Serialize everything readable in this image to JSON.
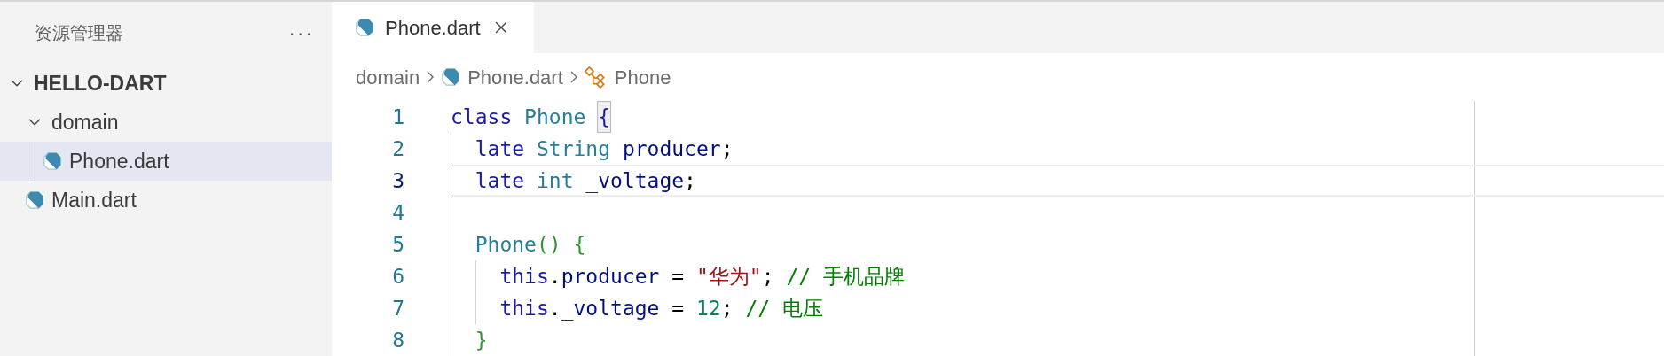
{
  "sidebar": {
    "title": "资源管理器",
    "more": "···",
    "tree": [
      {
        "kind": "folder",
        "label": "HELLO-DART",
        "bold": true,
        "expanded": true,
        "children": [
          {
            "kind": "folder",
            "label": "domain",
            "expanded": true,
            "children": [
              {
                "kind": "file",
                "label": "Phone.dart",
                "selected": true
              }
            ]
          },
          {
            "kind": "file",
            "label": "Main.dart",
            "selected": false
          }
        ]
      }
    ]
  },
  "tabs": [
    {
      "label": "Phone.dart",
      "selected": true
    }
  ],
  "breadcrumb": [
    {
      "kind": "folder",
      "label": "domain"
    },
    {
      "kind": "file",
      "label": "Phone.dart"
    },
    {
      "kind": "class",
      "label": "Phone"
    }
  ],
  "editor": {
    "lines": [
      {
        "number": "1",
        "current": false,
        "tokens": [
          {
            "kind": "keyword",
            "text": "class "
          },
          {
            "kind": "type",
            "text": "Phone "
          },
          {
            "kind": "bracket_match",
            "text": "{"
          }
        ]
      },
      {
        "number": "2",
        "current": false,
        "tokens": [
          {
            "kind": "keyword",
            "text": "  late "
          },
          {
            "kind": "type",
            "text": "String "
          },
          {
            "kind": "variable",
            "text": "producer"
          },
          {
            "kind": "plain",
            "text": ";"
          }
        ]
      },
      {
        "number": "3",
        "current": true,
        "tokens": [
          {
            "kind": "keyword",
            "text": "  late "
          },
          {
            "kind": "type",
            "text": "int "
          },
          {
            "kind": "variable",
            "text": "_voltage"
          },
          {
            "kind": "plain",
            "text": ";"
          }
        ]
      },
      {
        "number": "4",
        "current": false
      },
      {
        "number": "5",
        "current": false,
        "tokens": [
          {
            "kind": "type",
            "text": "  Phone"
          },
          {
            "kind": "bracket",
            "text": "() {"
          }
        ]
      },
      {
        "number": "6",
        "current": false,
        "tokens": [
          {
            "kind": "keyword",
            "text": "    this"
          },
          {
            "kind": "plain",
            "text": "."
          },
          {
            "kind": "variable",
            "text": "producer"
          },
          {
            "kind": "plain",
            "text": " = "
          },
          {
            "kind": "string",
            "text": "\"华为\""
          },
          {
            "kind": "plain",
            "text": "; "
          },
          {
            "kind": "comment",
            "text": "// 手机品牌"
          }
        ]
      },
      {
        "number": "7",
        "current": false,
        "tokens": [
          {
            "kind": "keyword",
            "text": "    this"
          },
          {
            "kind": "plain",
            "text": "."
          },
          {
            "kind": "variable",
            "text": "_voltage"
          },
          {
            "kind": "plain",
            "text": " = "
          },
          {
            "kind": "number",
            "text": "12"
          },
          {
            "kind": "plain",
            "text": "; "
          },
          {
            "kind": "comment",
            "text": "// 电压"
          }
        ]
      },
      {
        "number": "8",
        "current": false,
        "tokens": [
          {
            "kind": "bracket",
            "text": "  }"
          }
        ]
      }
    ]
  }
}
